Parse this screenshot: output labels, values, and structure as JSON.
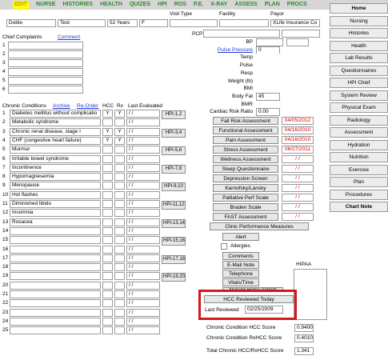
{
  "tabs": [
    "EDIT",
    "NURSE",
    "HISTORIES",
    "HEALTH",
    "QUIZES",
    "HPI",
    "ROS",
    "P.E.",
    "X-RAY",
    "ASSESS",
    "PLAN",
    "PROCS"
  ],
  "patient": {
    "first": "Dottie",
    "last": "Test",
    "age": "52 Years",
    "sex": "F",
    "visit_type_label": "Visit Type",
    "facility_label": "Facility",
    "payor_label": "Payor",
    "payor_value": "XLife Insurance Co",
    "pcp_label": "PCP"
  },
  "complaints": {
    "label": "Chief Complaints",
    "comment": "Comment",
    "rows": [
      "1",
      "2",
      "3",
      "4",
      "5",
      "6"
    ]
  },
  "vitals": {
    "bp": "BP",
    "pulse_pressure": "Pulse Pressure",
    "pulse_pressure_value": "0",
    "temp": "Temp",
    "pulse": "Pulse",
    "resp": "Resp",
    "weight": "Weight (lb)",
    "bmi": "BMI",
    "body_fat": "Body Fat",
    "body_fat_value": "45",
    "bmr": "BMR",
    "cardiac": "Cardiac Risk Ratio",
    "cardiac_value": "0.00"
  },
  "conditions": {
    "label": "Chronic Conditions",
    "archive": "Archive",
    "reorder": "Re-Order",
    "hcc": "HCC",
    "rx": "Rx",
    "last_evaluated": "Last Evaluated",
    "rows": [
      {
        "n": "1",
        "name": "Diabetes mellitus without complicatio",
        "hcc": "Y",
        "rx": "Y",
        "date": "/ /"
      },
      {
        "n": "2",
        "name": "Metabolic syndrome",
        "hcc": "",
        "rx": "",
        "date": "/ /"
      },
      {
        "n": "3",
        "name": "Chronic renal disease, stage I",
        "hcc": "Y",
        "rx": "Y",
        "date": "/ /"
      },
      {
        "n": "4",
        "name": "CHF (congestive heart failure)",
        "hcc": "Y",
        "rx": "Y",
        "date": "/ /"
      },
      {
        "n": "5",
        "name": "Murmur",
        "hcc": "",
        "rx": "",
        "date": "/ /"
      },
      {
        "n": "6",
        "name": "Irritable bowel syndrome",
        "hcc": "",
        "rx": "",
        "date": "/ /"
      },
      {
        "n": "7",
        "name": "Incontinence",
        "hcc": "",
        "rx": "",
        "date": "/ /"
      },
      {
        "n": "8",
        "name": "Hypomagnesemia",
        "hcc": "",
        "rx": "",
        "date": "/ /"
      },
      {
        "n": "9",
        "name": "Menopause",
        "hcc": "",
        "rx": "",
        "date": "/ /"
      },
      {
        "n": "10",
        "name": "Hot flashes",
        "hcc": "",
        "rx": "",
        "date": "/ /"
      },
      {
        "n": "11",
        "name": "Diminished libido",
        "hcc": "",
        "rx": "",
        "date": "/ /"
      },
      {
        "n": "12",
        "name": "Insomnia",
        "hcc": "",
        "rx": "",
        "date": "/ /"
      },
      {
        "n": "13",
        "name": "Rosacea",
        "hcc": "",
        "rx": "",
        "date": "/ /"
      },
      {
        "n": "14",
        "name": "",
        "hcc": "",
        "rx": "",
        "date": "/ /"
      },
      {
        "n": "15",
        "name": "",
        "hcc": "",
        "rx": "",
        "date": "/ /"
      },
      {
        "n": "16",
        "name": "",
        "hcc": "",
        "rx": "",
        "date": "/ /"
      },
      {
        "n": "17",
        "name": "",
        "hcc": "",
        "rx": "",
        "date": "/ /"
      },
      {
        "n": "18",
        "name": "",
        "hcc": "",
        "rx": "",
        "date": "/ /"
      },
      {
        "n": "19",
        "name": "",
        "hcc": "",
        "rx": "",
        "date": "/ /"
      },
      {
        "n": "20",
        "name": "",
        "hcc": "",
        "rx": "",
        "date": "/ /"
      },
      {
        "n": "21",
        "name": "",
        "hcc": "",
        "rx": "",
        "date": "/ /"
      },
      {
        "n": "22",
        "name": "",
        "hcc": "",
        "rx": "",
        "date": "/ /"
      },
      {
        "n": "23",
        "name": "",
        "hcc": "",
        "rx": "",
        "date": "/ /"
      },
      {
        "n": "24",
        "name": "",
        "hcc": "",
        "rx": "",
        "date": "/ /"
      },
      {
        "n": "25",
        "name": "",
        "hcc": "",
        "rx": "",
        "date": "/ /"
      }
    ],
    "hpi": [
      "HPI-1,2",
      "HPI-3,4",
      "HPI-5,6",
      "HPI-7,8",
      "HPI-9,10",
      "HPI-11,12",
      "HPI-13,14",
      "HPI-15,16",
      "HPI-17,18",
      "HPI-19,20"
    ]
  },
  "assessments": [
    {
      "label": "Fall Risk Assessment",
      "date": "04/05/2012"
    },
    {
      "label": "Functional Assessment",
      "date": "04/16/2010"
    },
    {
      "label": "Pain Assessment",
      "date": "04/16/2010"
    },
    {
      "label": "Stress Assessment",
      "date": "06/27/2011"
    },
    {
      "label": "Wellness Assessment",
      "date": "/ /"
    },
    {
      "label": "Sleep Questionnaire",
      "date": "/ /"
    },
    {
      "label": "Depression Screen",
      "date": "/ /"
    },
    {
      "label": "Karnofsky/Lansky",
      "date": "/ /"
    },
    {
      "label": "Palliative Perf Scale",
      "date": "/ /"
    },
    {
      "label": "Braden Scale",
      "date": "/ /"
    },
    {
      "label": "FAST Assessment",
      "date": "/ /"
    }
  ],
  "clinic": {
    "label": "Clinic Performance Measures",
    "alert": "Alert",
    "allergies": "Allergies",
    "comments": "Comments",
    "email": "E-Mail Note",
    "telephone": "Telephone",
    "vitals_time": "Vitals/Time",
    "nursing": "Nursing Home Patient",
    "hipaa": "HIPAA"
  },
  "hcc": {
    "reviewed_today": "HCC Reviewed Today",
    "last_reviewed_label": "Last Reviewed",
    "last_reviewed": "02/25/2009",
    "chronic_label": "Chronic Condition HCC Score",
    "chronic_value": "0.9400",
    "rx_label": "Chronic Condition RxHCC Score",
    "rx_value": "0.4010",
    "total_label": "Total Chronic HCC/RxHCC Score",
    "total_value": "1.341"
  },
  "nav": [
    "Home",
    "Nursing",
    "Histories",
    "Health",
    "Lab Results",
    "Questionnaires",
    "HPI Chief",
    "System Review",
    "Physical Exam",
    "Radiology",
    "Assessment",
    "Hydration",
    "Nutrition",
    "Exercise",
    "Plan",
    "Procedures",
    "Chart Note"
  ]
}
